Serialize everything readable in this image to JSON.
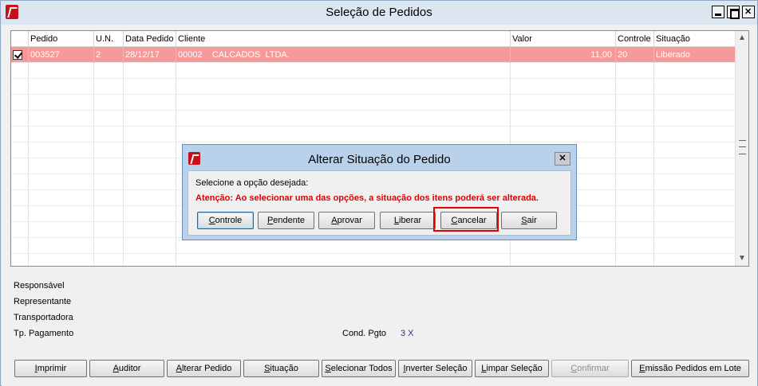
{
  "window": {
    "title": "Seleção de Pedidos"
  },
  "grid": {
    "columns": [
      "Pedido",
      "U.N.",
      "Data Pedido",
      "Cliente",
      "Valor",
      "Controle",
      "Situação"
    ],
    "rows": [
      {
        "checked": true,
        "pedido": "003527",
        "un": "2",
        "data": "28/12/17",
        "cliente": "00002    CALCADOS  LTDA.",
        "valor": "11,00",
        "controle": "20",
        "situacao": "Liberado"
      }
    ]
  },
  "info": {
    "responsavel_label": "Responsável",
    "representante_label": "Representante",
    "transportadora_label": "Transportadora",
    "tp_pagamento_label": "Tp. Pagamento",
    "cond_pgto_label": "Cond. Pgto",
    "cond_pgto_value": "3 X"
  },
  "toolbar": {
    "imprimir": "Imprimir",
    "auditor": "Auditor",
    "alterar_pedido": "Alterar Pedido",
    "situacao": "Situação",
    "selecionar_todos": "Selecionar Todos",
    "inverter_selecao": "Inverter Seleção",
    "limpar_selecao": "Limpar Seleção",
    "confirmar": "Confirmar",
    "emissao_pedidos": "Emissão Pedidos em Lote"
  },
  "dialog": {
    "title": "Alterar Situação do Pedido",
    "prompt": "Selecione a opção desejada:",
    "warning": "Atenção: Ao selecionar uma das opções, a situação dos itens poderá ser alterada.",
    "buttons": {
      "controle": "Controle",
      "pendente": "Pendente",
      "aprovar": "Aprovar",
      "liberar": "Liberar",
      "cancelar": "Cancelar",
      "sair": "Sair"
    }
  },
  "colors": {
    "selected_row": "#f59a9a",
    "warning": "#e00000",
    "highlight": "#e00000",
    "app_icon": "#c8101a"
  },
  "icons": [
    "app-logo-icon",
    "minimize-icon",
    "maximize-icon",
    "close-icon",
    "checkbox-checked-icon",
    "scroll-up-icon",
    "scroll-down-icon"
  ]
}
